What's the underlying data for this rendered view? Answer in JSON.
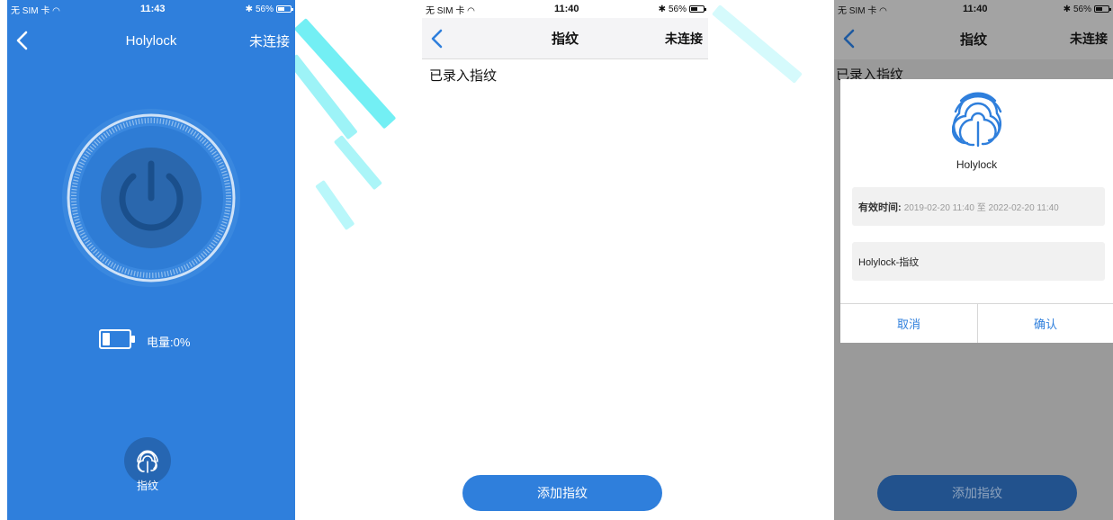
{
  "screen1": {
    "status": {
      "carrier": "无 SIM 卡",
      "time": "11:43",
      "battery": "56%"
    },
    "nav": {
      "title": "Holylock",
      "action": "未连接"
    },
    "power_label": "电量:0%",
    "battery_level": 0,
    "fingerprint_label": "指纹"
  },
  "screen2": {
    "status": {
      "carrier": "无 SIM 卡",
      "time": "11:40",
      "battery": "56%"
    },
    "nav": {
      "title": "指纹",
      "action": "未连接"
    },
    "section_label": "已录入指纹",
    "add_button": "添加指纹"
  },
  "screen3": {
    "status": {
      "carrier": "无 SIM 卡",
      "time": "11:40",
      "battery": "56%"
    },
    "nav": {
      "title": "指纹",
      "action": "未连接"
    },
    "section_label": "已录入指纹",
    "add_button": "添加指纹",
    "modal": {
      "name": "Holylock",
      "validity_label": "有效时间:",
      "validity_value": "2019-02-20 11:40 至 2022-02-20 11:40",
      "fingerprint_name": "Holylock-指纹",
      "cancel": "取消",
      "confirm": "确认"
    }
  },
  "colors": {
    "primary": "#2f7fdc",
    "dark_primary": "#2666b2",
    "overlay": "#9a9a9a"
  }
}
